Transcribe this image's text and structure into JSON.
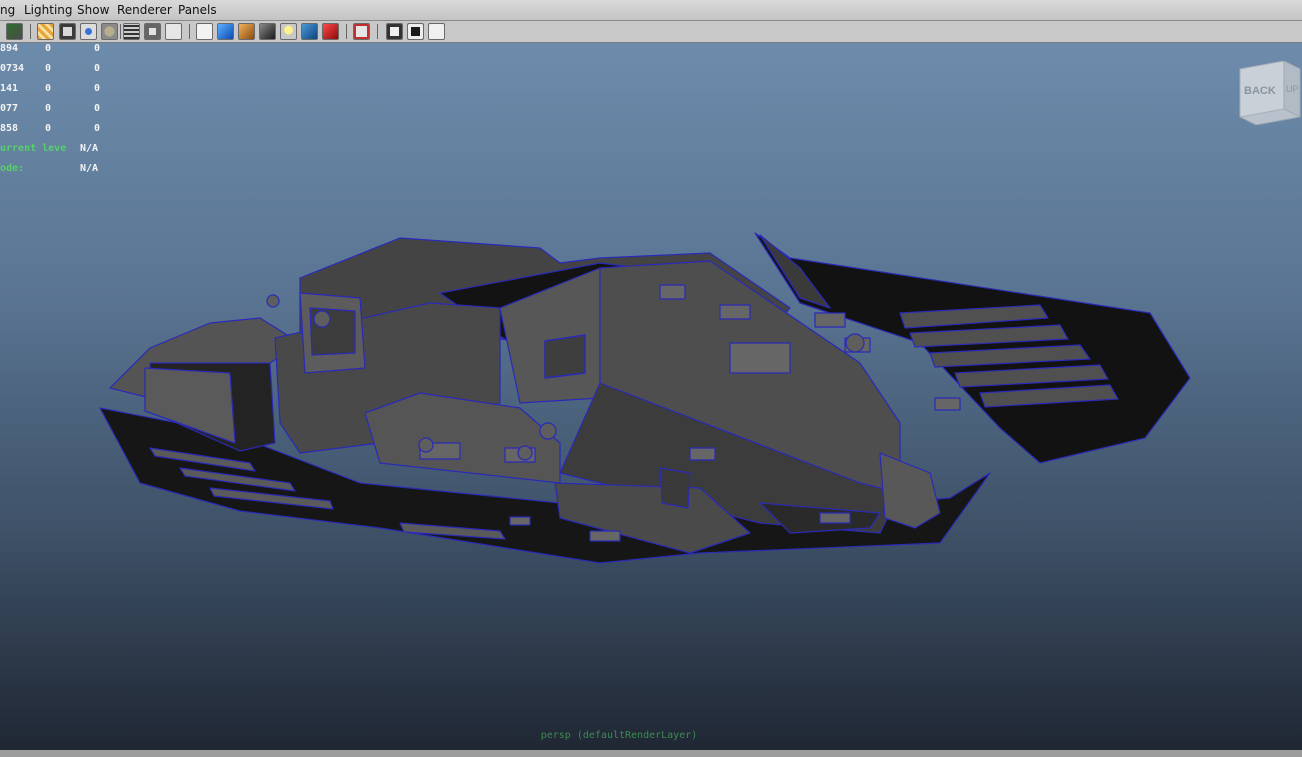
{
  "menubar": {
    "items": [
      "ng",
      "Lighting",
      "Show",
      "Renderer",
      "Panels"
    ]
  },
  "toolbar": {
    "icons": [
      "camera-icon",
      "grid-icon",
      "film-gate-icon",
      "resolution-gate-icon",
      "smooth-shade-icon",
      "wireframe-icon",
      "isolate-icon",
      "texture-icon",
      "wireframe-cube-icon",
      "shaded-cube-icon",
      "textured-cube-icon",
      "shadows-icon",
      "light-bulb-icon",
      "blue-cube-icon",
      "red-cube-icon",
      "frame-selection-icon",
      "xray-icon",
      "xray-joints-icon",
      "camera-attributes-icon"
    ]
  },
  "hud": {
    "rows": [
      [
        "894",
        "0",
        "0"
      ],
      [
        "0734",
        "0",
        "0"
      ],
      [
        "141",
        "0",
        "0"
      ],
      [
        "077",
        "0",
        "0"
      ],
      [
        "858",
        "0",
        "0"
      ]
    ],
    "current_level_label": "urrent leve",
    "current_level_value": "N/A",
    "mode_label": "ode:",
    "mode_value": "N/A"
  },
  "viewcube": {
    "face_label": "BACK",
    "side_label": "UP"
  },
  "camera_label": "persp (defaultRenderLayer)",
  "colors": {
    "viewport_top": "#6d8bab",
    "viewport_bottom": "#1f2733",
    "hud_green": "#56d06a",
    "wire_blue": "#2a2ab8",
    "mesh_gray": "#4b4b4b"
  }
}
